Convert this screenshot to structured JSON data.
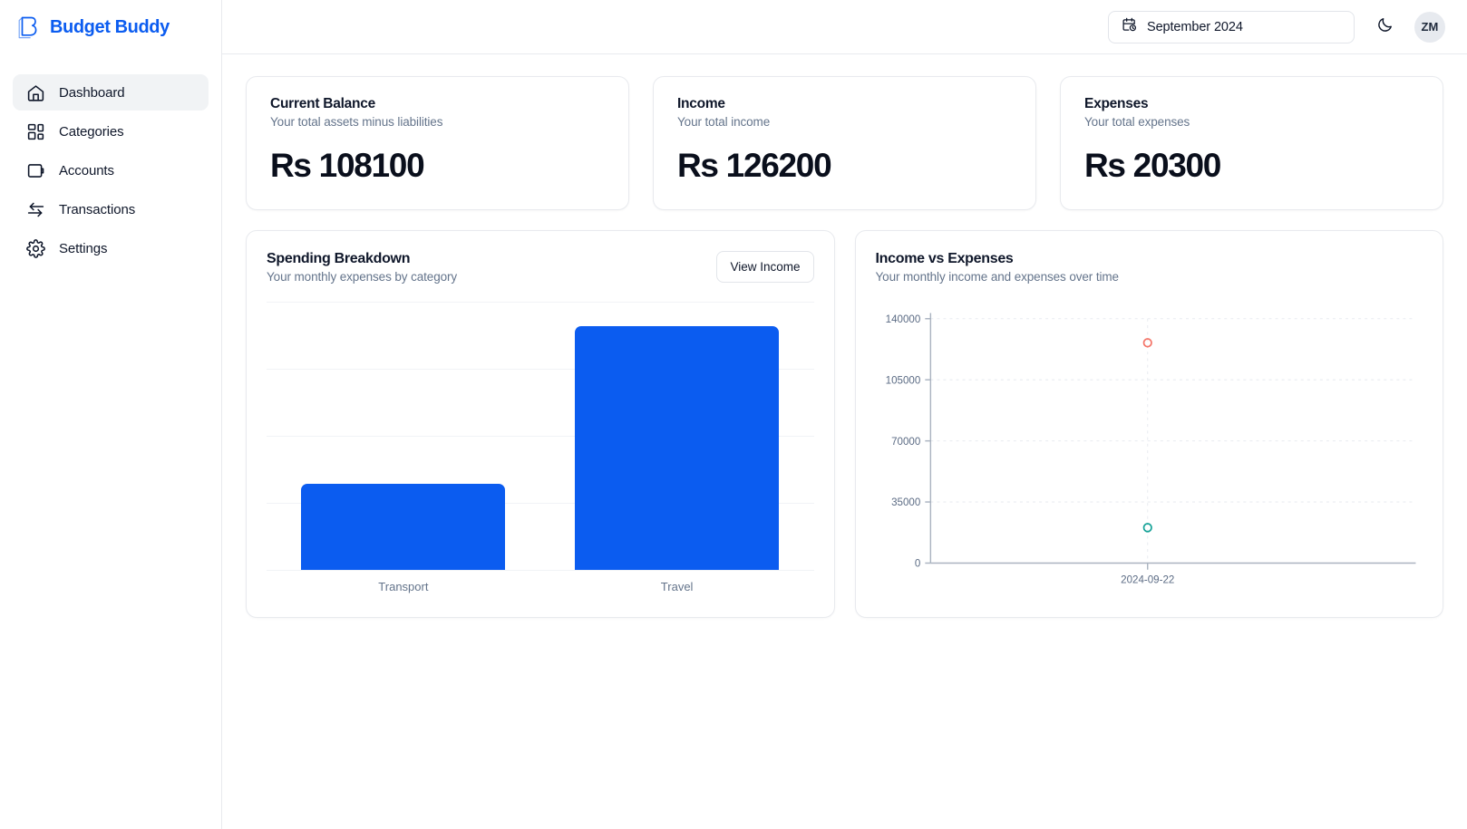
{
  "brand": {
    "name": "Budget Buddy",
    "logo_icon": "budget-buddy-b-logo",
    "color": "#0b5cf0"
  },
  "sidebar": {
    "items": [
      {
        "label": "Dashboard",
        "icon": "home-icon",
        "active": true
      },
      {
        "label": "Categories",
        "icon": "grid-icon",
        "active": false
      },
      {
        "label": "Accounts",
        "icon": "wallet-icon",
        "active": false
      },
      {
        "label": "Transactions",
        "icon": "transfer-arrows-icon",
        "active": false
      },
      {
        "label": "Settings",
        "icon": "gear-icon",
        "active": false
      }
    ]
  },
  "topbar": {
    "date_picker": {
      "value": "September 2024",
      "icon": "calendar-clock-icon"
    },
    "theme_toggle": {
      "icon": "moon-icon",
      "state": "light"
    },
    "avatar": {
      "initials": "ZM"
    }
  },
  "stats": [
    {
      "title": "Current Balance",
      "subtitle": "Your total assets minus liabilities",
      "value": "Rs 108100",
      "amount": 108100,
      "currency": "Rs"
    },
    {
      "title": "Income",
      "subtitle": "Your total income",
      "value": "Rs 126200",
      "amount": 126200,
      "currency": "Rs"
    },
    {
      "title": "Expenses",
      "subtitle": "Your total expenses",
      "value": "Rs 20300",
      "amount": 20300,
      "currency": "Rs"
    }
  ],
  "spending_panel": {
    "title": "Spending Breakdown",
    "subtitle": "Your monthly expenses by category",
    "toggle_button": "View Income"
  },
  "income_panel": {
    "title": "Income vs Expenses",
    "subtitle": "Your monthly income and expenses over time"
  },
  "chart_data": [
    {
      "type": "bar",
      "title": "Spending Breakdown",
      "subtitle": "Your monthly expenses by category",
      "categories": [
        "Transport",
        "Travel"
      ],
      "values": [
        5300,
        15000
      ],
      "series": [
        {
          "name": "Expenses",
          "values": [
            5300,
            15000
          ],
          "color": "#0b5cf0"
        }
      ],
      "xlabel": "",
      "ylabel": "",
      "ylim": [
        0,
        16500
      ],
      "grid": true,
      "y_ticks_visible": false,
      "legend": "none",
      "bar_color": "#0b5cf0",
      "bar_radius_top": 7
    },
    {
      "type": "line",
      "title": "Income vs Expenses",
      "subtitle": "Your monthly income and expenses over time",
      "x": [
        "2024-09-22"
      ],
      "xtick_labels": [
        "2024-09-22"
      ],
      "ytick_labels": [
        "0",
        "35000",
        "70000",
        "105000",
        "140000"
      ],
      "ytick_values": [
        0,
        35000,
        70000,
        105000,
        140000
      ],
      "series": [
        {
          "name": "Income",
          "values": [
            126200
          ],
          "color": "#f4766a",
          "marker": "open-circle"
        },
        {
          "name": "Expenses",
          "values": [
            20300
          ],
          "color": "#17a398",
          "marker": "open-circle"
        }
      ],
      "xlabel": "",
      "ylabel": "",
      "ylim": [
        0,
        140000
      ],
      "grid": true,
      "grid_style": "dashed",
      "legend": "none"
    }
  ]
}
